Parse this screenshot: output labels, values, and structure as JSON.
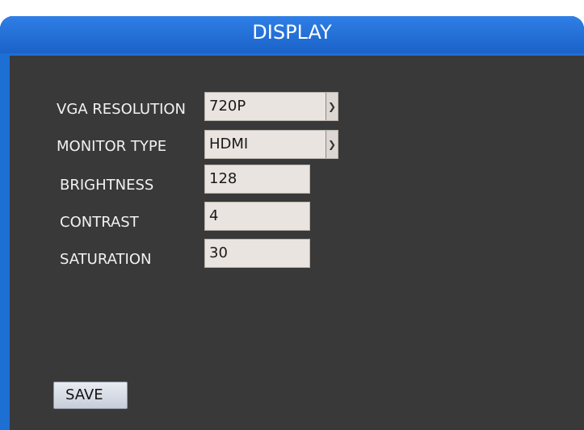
{
  "window": {
    "title": "DISPLAY"
  },
  "form": {
    "vga_resolution": {
      "label": "VGA RESOLUTION",
      "value": "720P"
    },
    "monitor_type": {
      "label": "MONITOR TYPE",
      "value": "HDMI"
    },
    "brightness": {
      "label": "BRIGHTNESS",
      "value": "128"
    },
    "contrast": {
      "label": "CONTRAST",
      "value": "4"
    },
    "saturation": {
      "label": "SATURATION",
      "value": "30"
    }
  },
  "actions": {
    "save_label": "SAVE"
  },
  "icons": {
    "dropdown": "chevron-down-icon"
  },
  "colors": {
    "title_bar": "#1e6fd4",
    "panel": "#3a3939",
    "field_bg": "#e9e4df",
    "text": "#f2f2f2"
  }
}
